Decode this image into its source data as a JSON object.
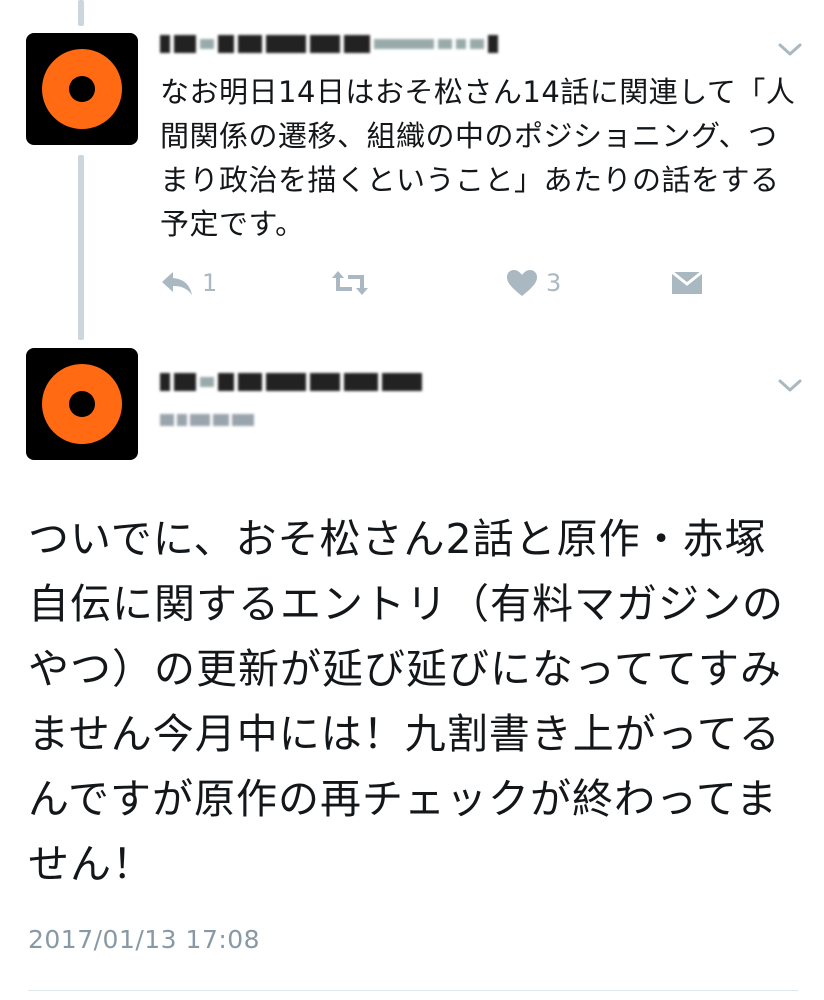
{
  "tweet1": {
    "text": "なお明日14日はおそ松さん14話に関連して「人間関係の遷移、組織の中のポジショニング、つまり政治を描くということ」あたりの話をする予定です。",
    "reply_count": "1",
    "like_count": "3",
    "icons": {
      "reply": "reply-icon",
      "retweet": "retweet-icon",
      "like": "heart-icon",
      "dm": "envelope-icon",
      "menu": "chevron-down-icon"
    }
  },
  "tweet2": {
    "text": "ついでに、おそ松さん2話と原作・赤塚自伝に関するエントリ（有料マガジンのやつ）の更新が延び延びになっててすみません今月中には！九割書き上がってるんですが原作の再チェックが終わってません！",
    "timestamp": "2017/01/13 17:08",
    "icons": {
      "menu": "chevron-down-icon"
    }
  },
  "colors": {
    "avatar_ring": "#ff6a13",
    "avatar_bg": "#000000",
    "action_gray": "#aab8c2",
    "meta_gray": "#8899a6",
    "thread_line": "#ccd6dd"
  }
}
